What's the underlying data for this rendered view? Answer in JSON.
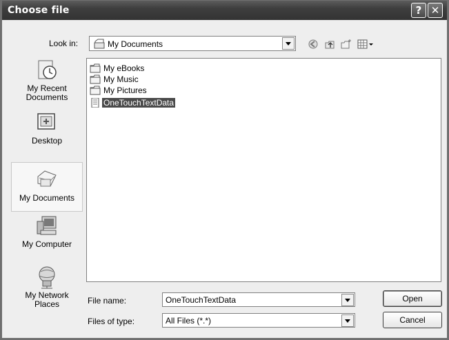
{
  "window": {
    "title": "Choose file"
  },
  "titlebar": {
    "help_glyph": "?",
    "close_glyph": "✕"
  },
  "lookin": {
    "label": "Look in:",
    "value": "My Documents",
    "icon": "my-documents-icon"
  },
  "toolbar": {
    "items": [
      {
        "name": "back-icon",
        "glyph": "◐"
      },
      {
        "name": "up-folder-icon",
        "glyph": "⇧"
      },
      {
        "name": "new-folder-icon",
        "glyph": "✱"
      },
      {
        "name": "view-menu-icon",
        "glyph": "▦▾"
      }
    ]
  },
  "places": [
    {
      "label_lines": [
        "My Recent",
        "Documents"
      ],
      "icon": "recent-documents-icon",
      "selected": false
    },
    {
      "label_lines": [
        "Desktop"
      ],
      "icon": "desktop-icon",
      "selected": false
    },
    {
      "label_lines": [
        "My Documents"
      ],
      "icon": "my-documents-icon",
      "selected": true
    },
    {
      "label_lines": [
        "My Computer"
      ],
      "icon": "my-computer-icon",
      "selected": false
    },
    {
      "label_lines": [
        "My Network",
        "Places"
      ],
      "icon": "network-places-icon",
      "selected": false
    }
  ],
  "files": [
    {
      "label": "My eBooks",
      "type": "folder",
      "selected": false
    },
    {
      "label": "My Music",
      "type": "folder",
      "selected": false
    },
    {
      "label": "My Pictures",
      "type": "folder",
      "selected": false
    },
    {
      "label": "OneTouchTextData",
      "type": "file",
      "selected": true
    }
  ],
  "filename": {
    "label": "File name:",
    "value": "OneTouchTextData"
  },
  "filetype": {
    "label": "Files of type:",
    "value": "All Files (*.*)"
  },
  "buttons": {
    "open": "Open",
    "cancel": "Cancel"
  }
}
